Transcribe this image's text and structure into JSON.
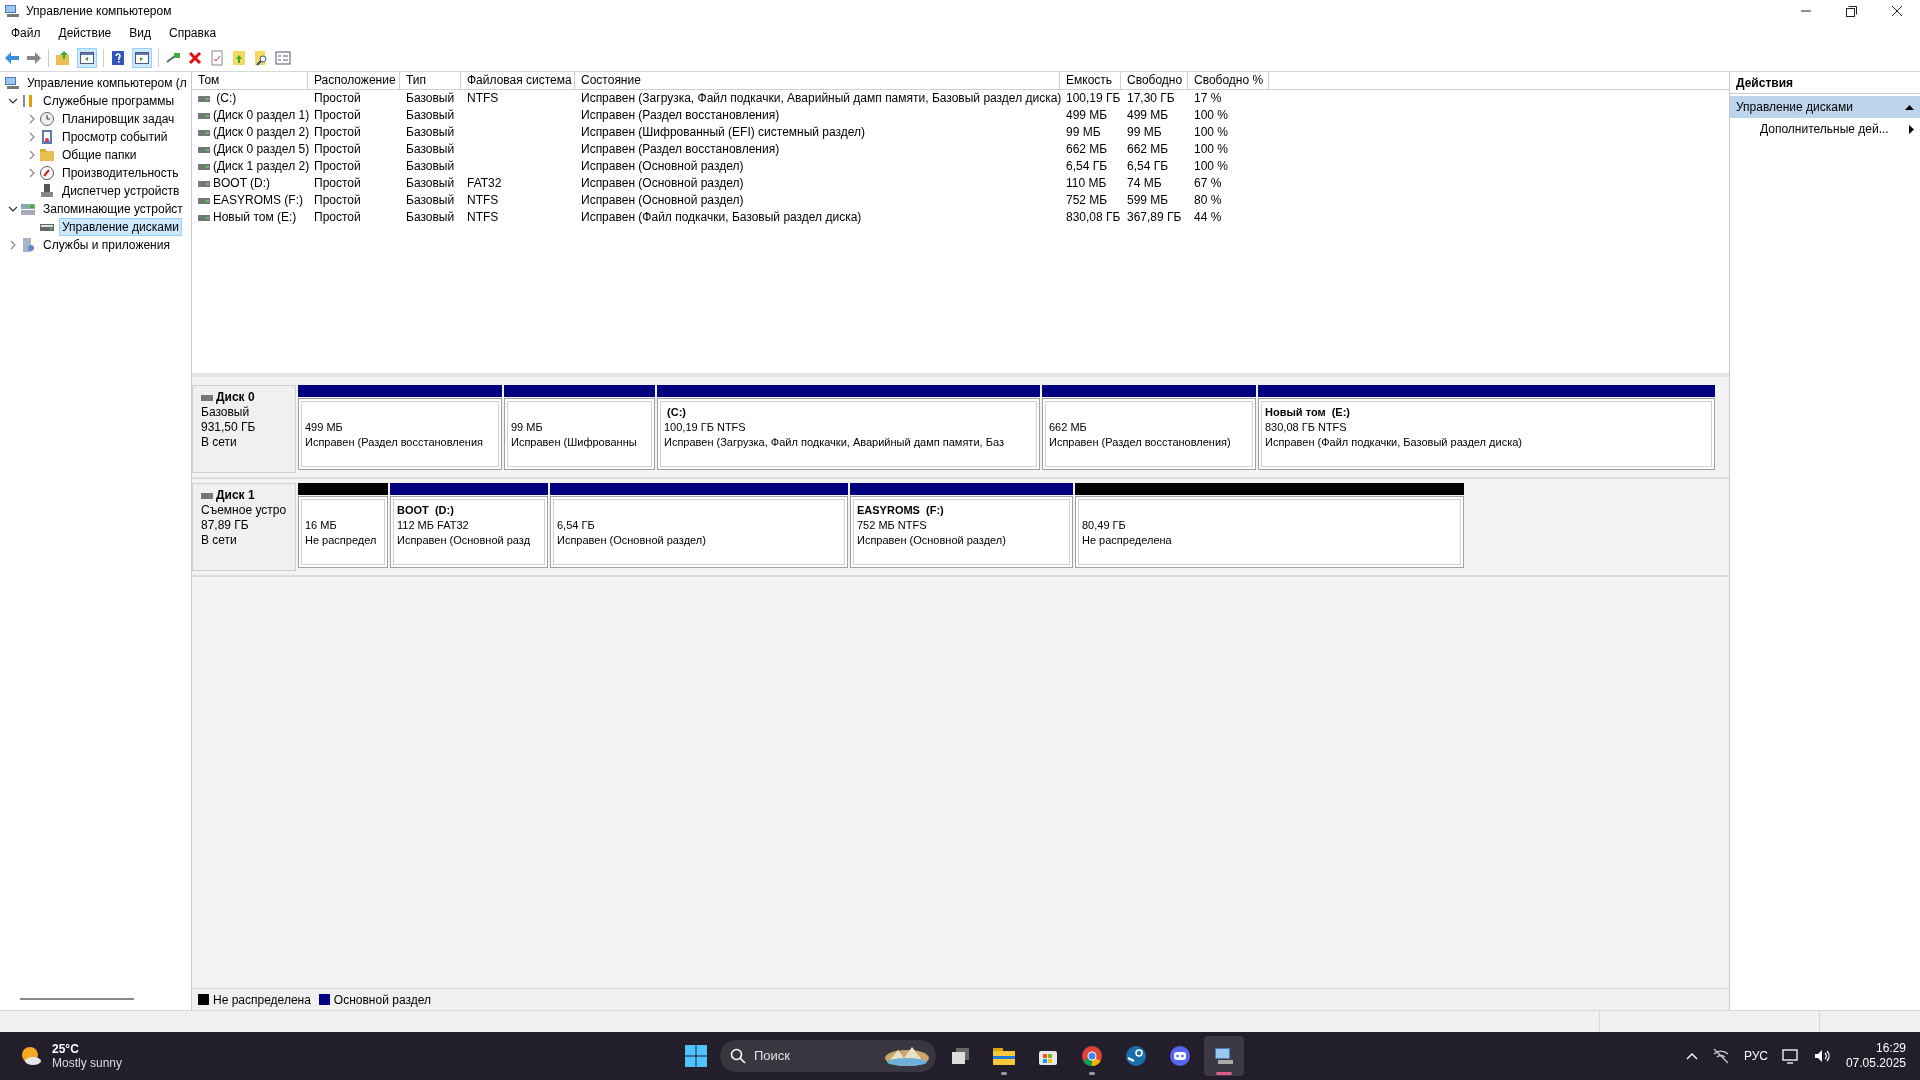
{
  "window": {
    "title": "Управление компьютером"
  },
  "menu": [
    "Файл",
    "Действие",
    "Вид",
    "Справка"
  ],
  "toolbar": {
    "console_tree_on": true,
    "action_pane_on": true
  },
  "tree": [
    {
      "label": "Управление компьютером (л",
      "kind": "computer",
      "selected": false,
      "children": [
        {
          "label": "Служебные программы",
          "kind": "tools",
          "expanded": true,
          "selected": false,
          "children": [
            {
              "label": "Планировщик задач",
              "kind": "clock",
              "expanded": false,
              "selected": false
            },
            {
              "label": "Просмотр событий",
              "kind": "events",
              "expanded": false,
              "selected": false
            },
            {
              "label": "Общие папки",
              "kind": "folders",
              "expanded": false,
              "selected": false
            },
            {
              "label": "Производительность",
              "kind": "perf",
              "expanded": false,
              "selected": false
            },
            {
              "label": "Диспетчер устройств",
              "kind": "devices",
              "selected": false
            }
          ]
        },
        {
          "label": "Запоминающие устройст",
          "kind": "storage",
          "expanded": true,
          "selected": false,
          "children": [
            {
              "label": "Управление дисками",
              "kind": "disk",
              "selected": true
            }
          ]
        },
        {
          "label": "Службы и приложения",
          "kind": "services",
          "expanded": false,
          "selected": false
        }
      ]
    }
  ],
  "table": {
    "columns": [
      "Том",
      "Расположение",
      "Тип",
      "Файловая система",
      "Состояние",
      "Емкость",
      "Свободно",
      "Свободно %"
    ],
    "rows": [
      {
        "cells": [
          " (C:)",
          "Простой",
          "Базовый",
          "NTFS",
          "Исправен (Загрузка, Файл подкачки, Аварийный дамп памяти, Базовый раздел диска)",
          "100,19 ГБ",
          "17,30 ГБ",
          "17 %"
        ]
      },
      {
        "cells": [
          "(Диск 0 раздел 1)",
          "Простой",
          "Базовый",
          "",
          "Исправен (Раздел восстановления)",
          "499 МБ",
          "499 МБ",
          "100 %"
        ]
      },
      {
        "cells": [
          "(Диск 0 раздел 2)",
          "Простой",
          "Базовый",
          "",
          "Исправен (Шифрованный (EFI) системный раздел)",
          "99 МБ",
          "99 МБ",
          "100 %"
        ]
      },
      {
        "cells": [
          "(Диск 0 раздел 5)",
          "Простой",
          "Базовый",
          "",
          "Исправен (Раздел восстановления)",
          "662 МБ",
          "662 МБ",
          "100 %"
        ]
      },
      {
        "cells": [
          "(Диск 1 раздел 2)",
          "Простой",
          "Базовый",
          "",
          "Исправен (Основной раздел)",
          "6,54 ГБ",
          "6,54 ГБ",
          "100 %"
        ]
      },
      {
        "cells": [
          "BOOT (D:)",
          "Простой",
          "Базовый",
          "FAT32",
          "Исправен (Основной раздел)",
          "110 МБ",
          "74 МБ",
          "67 %"
        ]
      },
      {
        "cells": [
          "EASYROMS (F:)",
          "Простой",
          "Базовый",
          "NTFS",
          "Исправен (Основной раздел)",
          "752 МБ",
          "599 МБ",
          "80 %"
        ]
      },
      {
        "cells": [
          "Новый том (E:)",
          "Простой",
          "Базовый",
          "NTFS",
          "Исправен (Файл подкачки, Базовый раздел диска)",
          "830,08 ГБ",
          "367,89 ГБ",
          "44 %"
        ]
      }
    ]
  },
  "disks": [
    {
      "name": "Диск 0",
      "type": "Базовый",
      "size": "931,50 ГБ",
      "status": "В сети",
      "partitions": [
        {
          "kind": "primary",
          "size": "499 МБ",
          "status": "Исправен (Раздел восстановления"
        },
        {
          "kind": "primary",
          "size": "99 МБ",
          "status": "Исправен (Шифрованны"
        },
        {
          "kind": "primary",
          "title": " (C:)",
          "size": "100,19 ГБ NTFS",
          "status": "Исправен (Загрузка, Файл подкачки, Аварийный дамп памяти, Баз"
        },
        {
          "kind": "primary",
          "size": "662 МБ",
          "status": "Исправен (Раздел восстановления)"
        },
        {
          "kind": "primary",
          "title": "Новый том  (E:)",
          "size": "830,08 ГБ NTFS",
          "status": "Исправен (Файл подкачки, Базовый раздел диска)"
        }
      ]
    },
    {
      "name": "Диск 1",
      "type": "Съемное устро",
      "size": "87,89 ГБ",
      "status": "В сети",
      "partitions": [
        {
          "kind": "unallocated",
          "size": "16 МБ",
          "status": "Не распредел"
        },
        {
          "kind": "primary",
          "title": "BOOT  (D:)",
          "size": "112 МБ FAT32",
          "status": "Исправен (Основной разд"
        },
        {
          "kind": "primary",
          "size": "6,54 ГБ",
          "status": "Исправен (Основной раздел)"
        },
        {
          "kind": "primary",
          "title": "EASYROMS  (F:)",
          "size": "752 МБ NTFS",
          "status": "Исправен (Основной раздел)"
        },
        {
          "kind": "unallocated",
          "size": "80,49 ГБ",
          "status": "Не распределена"
        }
      ]
    }
  ],
  "legend": [
    {
      "kind": "unallocated",
      "label": "Не распределена"
    },
    {
      "kind": "primary",
      "label": "Основной раздел"
    }
  ],
  "actions": {
    "title": "Действия",
    "items": [
      {
        "kind": "header",
        "label": "Управление дисками",
        "expanded": true
      },
      {
        "kind": "more",
        "label": "Дополнительные дей..."
      }
    ]
  },
  "taskbar": {
    "weather": {
      "temp": "25°C",
      "desc": "Mostly sunny"
    },
    "search": {
      "placeholder": "Поиск"
    },
    "apps": [
      {
        "kind": "taskview",
        "running": false,
        "active": false
      },
      {
        "kind": "explorer",
        "running": true,
        "active": false
      },
      {
        "kind": "store",
        "running": false,
        "active": false
      },
      {
        "kind": "chrome",
        "running": true,
        "active": false
      },
      {
        "kind": "steam",
        "running": false,
        "active": false
      },
      {
        "kind": "discord",
        "running": false,
        "active": false
      },
      {
        "kind": "compmgmt",
        "running": true,
        "active": true
      }
    ],
    "language": "РУС",
    "time": "16:29",
    "date": "07.05.2025"
  }
}
